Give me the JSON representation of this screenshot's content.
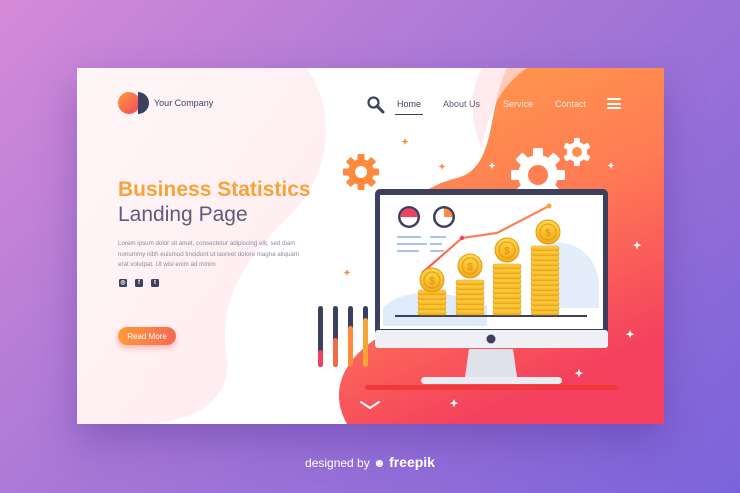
{
  "header": {
    "company_name": "Your Company",
    "search_icon": "search-icon",
    "nav": [
      {
        "label": "Home",
        "active": true
      },
      {
        "label": "About Us"
      },
      {
        "label": "Service"
      },
      {
        "label": "Contact"
      }
    ],
    "menu_icon": "hamburger-menu-icon"
  },
  "hero": {
    "title_line1": "Business Statistics",
    "title_line2": "Landing Page",
    "description": "Lorem ipsum dolor sit amet, consectetur adipiscing elit, sed diam nonummy nibh euismod tincidunt ut laoreet dolore magna aliquam erat volutpat. Ut wisi enim ad minim",
    "social": [
      "instagram-icon",
      "facebook-icon",
      "twitter-icon"
    ],
    "cta_label": "Read More"
  },
  "footer": {
    "prefix": "designed by",
    "brand": "freepik"
  },
  "colors": {
    "accent_orange": "#f6a33a",
    "accent_red": "#f2475e",
    "dark_navy": "#3c3f5e",
    "coin_gold": "#f5c518"
  }
}
